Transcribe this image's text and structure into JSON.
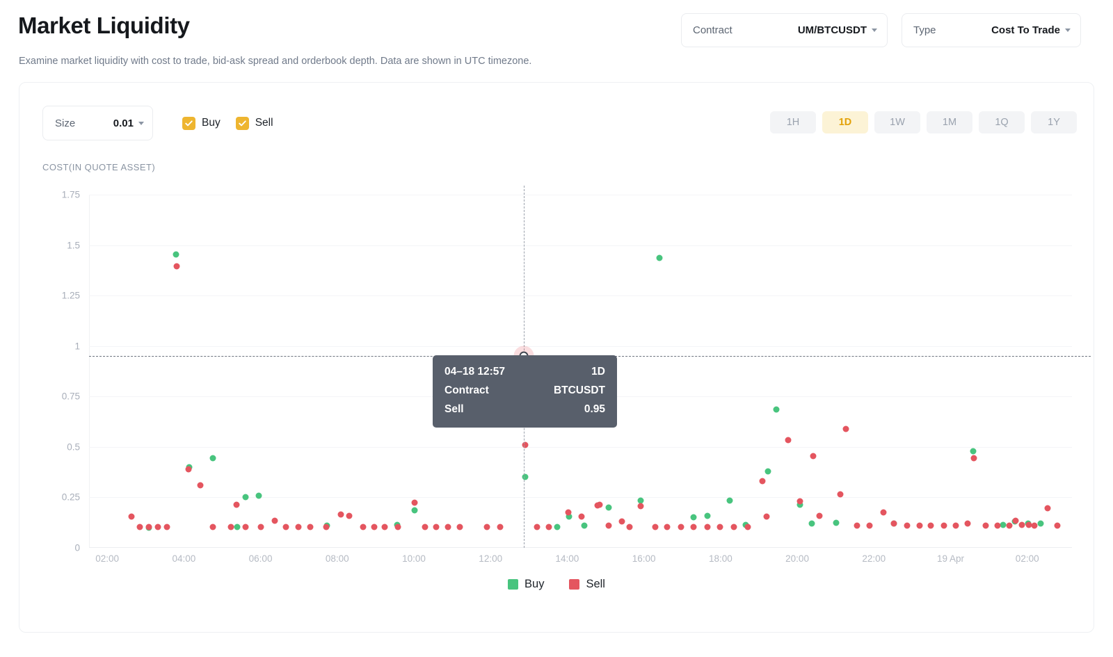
{
  "header": {
    "title": "Market Liquidity",
    "subtitle": "Examine market liquidity with cost to trade, bid-ask spread and orderbook depth. Data are shown in UTC timezone.",
    "contract": {
      "label": "Contract",
      "value": "UM/BTCUSDT"
    },
    "type": {
      "label": "Type",
      "value": "Cost To Trade"
    }
  },
  "toolbar": {
    "size": {
      "label": "Size",
      "value": "0.01"
    },
    "buy_checkbox": {
      "label": "Buy",
      "checked": true
    },
    "sell_checkbox": {
      "label": "Sell",
      "checked": true
    },
    "ranges": [
      "1H",
      "1D",
      "1W",
      "1M",
      "1Q",
      "1Y"
    ],
    "active_range": "1D"
  },
  "tooltip": {
    "time": "04–18 12:57",
    "range": "1D",
    "contract_label": "Contract",
    "contract_value": "BTCUSDT",
    "series_label": "Sell",
    "series_value": "0.95"
  },
  "colors": {
    "buy": "#48c47e",
    "sell": "#e4555f",
    "accent": "#eeb530",
    "active_range_bg": "#fcf3d6",
    "active_range_fg": "#e3a209",
    "tooltip_bg": "#585f6b"
  },
  "chart_data": {
    "type": "scatter",
    "title": "",
    "ylabel": "COST(IN QUOTE ASSET)",
    "xlabel": "",
    "ylim": [
      0,
      1.75
    ],
    "yticks": [
      0,
      0.25,
      0.5,
      0.75,
      1,
      1.25,
      1.5,
      1.75
    ],
    "ytick_labels": [
      "0",
      "0.25",
      "0.5",
      "0.75",
      "1",
      "1.25",
      "1.5",
      "1.75"
    ],
    "xtick_labels": [
      "02:00",
      "04:00",
      "06:00",
      "08:00",
      "10:00",
      "12:00",
      "14:00",
      "16:00",
      "18:00",
      "20:00",
      "22:00",
      "19 Apr",
      "02:00"
    ],
    "xtick_positions": [
      0.0185,
      0.0965,
      0.1745,
      0.2525,
      0.3305,
      0.4085,
      0.4865,
      0.5645,
      0.6425,
      0.7205,
      0.7985,
      0.8765,
      0.9545
    ],
    "grid": true,
    "legend_position": "bottom",
    "legend": [
      "Buy",
      "Sell"
    ],
    "crosshair": {
      "x_frac": 0.442,
      "y_value": 0.95
    },
    "series": [
      {
        "name": "Buy",
        "color": "#48c47e",
        "points": [
          [
            0.0885,
            1.455
          ],
          [
            0.061,
            0.1
          ],
          [
            0.102,
            0.4
          ],
          [
            0.126,
            0.445
          ],
          [
            0.159,
            0.25
          ],
          [
            0.173,
            0.26
          ],
          [
            0.1505,
            0.105
          ],
          [
            0.3135,
            0.115
          ],
          [
            0.331,
            0.185
          ],
          [
            0.5805,
            1.435
          ],
          [
            0.4435,
            0.35
          ],
          [
            0.476,
            0.105
          ],
          [
            0.488,
            0.155
          ],
          [
            0.504,
            0.11
          ],
          [
            0.529,
            0.2
          ],
          [
            0.561,
            0.235
          ],
          [
            0.615,
            0.15
          ],
          [
            0.6295,
            0.16
          ],
          [
            0.652,
            0.235
          ],
          [
            0.668,
            0.115
          ],
          [
            0.6905,
            0.38
          ],
          [
            0.699,
            0.685
          ],
          [
            0.723,
            0.215
          ],
          [
            0.735,
            0.12
          ],
          [
            0.76,
            0.125
          ],
          [
            0.8995,
            0.48
          ],
          [
            0.942,
            0.13
          ],
          [
            0.9555,
            0.12
          ],
          [
            0.968,
            0.12
          ],
          [
            0.242,
            0.11
          ],
          [
            0.819,
            0.12
          ],
          [
            0.93,
            0.115
          ]
        ]
      },
      {
        "name": "Sell",
        "color": "#e4555f",
        "points": [
          [
            0.089,
            1.395
          ],
          [
            0.0435,
            0.155
          ],
          [
            0.052,
            0.105
          ],
          [
            0.061,
            0.105
          ],
          [
            0.07,
            0.105
          ],
          [
            0.079,
            0.105
          ],
          [
            0.101,
            0.39
          ],
          [
            0.113,
            0.31
          ],
          [
            0.15,
            0.215
          ],
          [
            0.1445,
            0.105
          ],
          [
            0.159,
            0.105
          ],
          [
            0.189,
            0.135
          ],
          [
            0.2,
            0.105
          ],
          [
            0.213,
            0.105
          ],
          [
            0.225,
            0.105
          ],
          [
            0.241,
            0.105
          ],
          [
            0.256,
            0.165
          ],
          [
            0.265,
            0.16
          ],
          [
            0.279,
            0.105
          ],
          [
            0.29,
            0.105
          ],
          [
            0.301,
            0.105
          ],
          [
            0.314,
            0.105
          ],
          [
            0.331,
            0.225
          ],
          [
            0.342,
            0.105
          ],
          [
            0.353,
            0.105
          ],
          [
            0.365,
            0.105
          ],
          [
            0.377,
            0.105
          ],
          [
            0.4435,
            0.51
          ],
          [
            0.456,
            0.105
          ],
          [
            0.468,
            0.105
          ],
          [
            0.4875,
            0.175
          ],
          [
            0.501,
            0.155
          ],
          [
            0.517,
            0.21
          ],
          [
            0.5195,
            0.215
          ],
          [
            0.529,
            0.11
          ],
          [
            0.542,
            0.13
          ],
          [
            0.55,
            0.105
          ],
          [
            0.561,
            0.205
          ],
          [
            0.576,
            0.105
          ],
          [
            0.588,
            0.105
          ],
          [
            0.602,
            0.105
          ],
          [
            0.615,
            0.105
          ],
          [
            0.629,
            0.105
          ],
          [
            0.642,
            0.105
          ],
          [
            0.656,
            0.105
          ],
          [
            0.67,
            0.105
          ],
          [
            0.685,
            0.33
          ],
          [
            0.689,
            0.155
          ],
          [
            0.711,
            0.535
          ],
          [
            0.723,
            0.23
          ],
          [
            0.737,
            0.455
          ],
          [
            0.743,
            0.16
          ],
          [
            0.764,
            0.265
          ],
          [
            0.77,
            0.59
          ],
          [
            0.781,
            0.11
          ],
          [
            0.794,
            0.11
          ],
          [
            0.808,
            0.175
          ],
          [
            0.819,
            0.12
          ],
          [
            0.832,
            0.11
          ],
          [
            0.845,
            0.11
          ],
          [
            0.856,
            0.11
          ],
          [
            0.87,
            0.11
          ],
          [
            0.882,
            0.11
          ],
          [
            0.894,
            0.12
          ],
          [
            0.9,
            0.445
          ],
          [
            0.912,
            0.11
          ],
          [
            0.924,
            0.11
          ],
          [
            0.936,
            0.11
          ],
          [
            0.943,
            0.135
          ],
          [
            0.949,
            0.115
          ],
          [
            0.956,
            0.115
          ],
          [
            0.962,
            0.11
          ],
          [
            0.975,
            0.195
          ],
          [
            0.985,
            0.11
          ],
          [
            0.405,
            0.105
          ],
          [
            0.418,
            0.105
          ],
          [
            0.126,
            0.105
          ],
          [
            0.1745,
            0.105
          ]
        ]
      }
    ]
  }
}
